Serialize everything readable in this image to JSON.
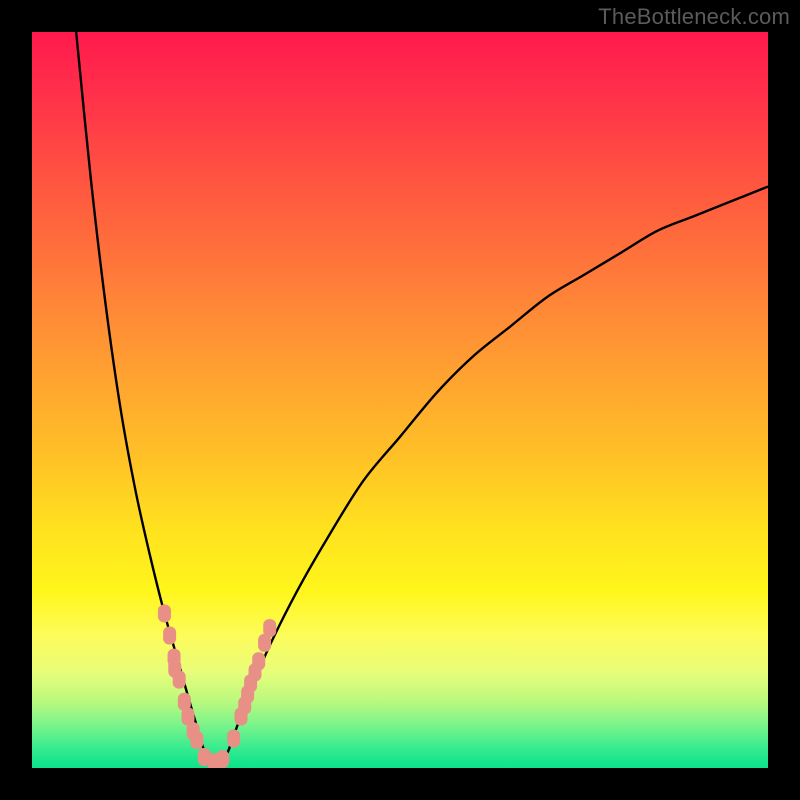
{
  "watermark": "TheBottleneck.com",
  "chart_data": {
    "type": "line",
    "title": "",
    "xlabel": "",
    "ylabel": "",
    "xlim": [
      0,
      100
    ],
    "ylim": [
      0,
      100
    ],
    "grid": false,
    "legend": false,
    "notes": "V-shaped bottleneck curve on continuous red→green vertical gradient. Minimum (0% bottleneck) at x≈24. Left branch rises steeply to 100% at x≈6; right branch rises gradually, asymptoting near y≈80 at x=100. Salmon-colored markers cluster near the trough on both branches.",
    "series": [
      {
        "name": "bottleneck-curve",
        "x": [
          6,
          8,
          10,
          12,
          14,
          16,
          18,
          20,
          22,
          24,
          26,
          28,
          30,
          32,
          36,
          40,
          45,
          50,
          55,
          60,
          65,
          70,
          75,
          80,
          85,
          90,
          95,
          100
        ],
        "y": [
          100,
          80,
          63,
          49,
          38,
          29,
          21,
          14,
          7,
          1,
          1,
          6,
          11,
          16,
          24,
          31,
          39,
          45,
          51,
          56,
          60,
          64,
          67,
          70,
          73,
          75,
          77,
          79
        ]
      }
    ],
    "markers": {
      "name": "trough-markers",
      "color": "#e88f86",
      "points": [
        {
          "x": 18,
          "y": 21
        },
        {
          "x": 18.7,
          "y": 18
        },
        {
          "x": 19.3,
          "y": 15
        },
        {
          "x": 19.4,
          "y": 13.5
        },
        {
          "x": 20.0,
          "y": 12
        },
        {
          "x": 20.7,
          "y": 9
        },
        {
          "x": 21.2,
          "y": 7
        },
        {
          "x": 21.9,
          "y": 5
        },
        {
          "x": 22.4,
          "y": 3.8
        },
        {
          "x": 23.4,
          "y": 1.5
        },
        {
          "x": 24.7,
          "y": 0.8
        },
        {
          "x": 25.9,
          "y": 1.2
        },
        {
          "x": 27.4,
          "y": 4
        },
        {
          "x": 28.4,
          "y": 7
        },
        {
          "x": 28.9,
          "y": 8.5
        },
        {
          "x": 29.3,
          "y": 10
        },
        {
          "x": 29.7,
          "y": 11.5
        },
        {
          "x": 30.3,
          "y": 13
        },
        {
          "x": 30.8,
          "y": 14.5
        },
        {
          "x": 31.6,
          "y": 17
        },
        {
          "x": 32.3,
          "y": 19
        }
      ]
    },
    "gradient_stops": [
      {
        "pos": 0,
        "color": "#ff1a4d"
      },
      {
        "pos": 50,
        "color": "#ffb12c"
      },
      {
        "pos": 75,
        "color": "#fff31d"
      },
      {
        "pos": 100,
        "color": "#10e38b"
      }
    ]
  }
}
